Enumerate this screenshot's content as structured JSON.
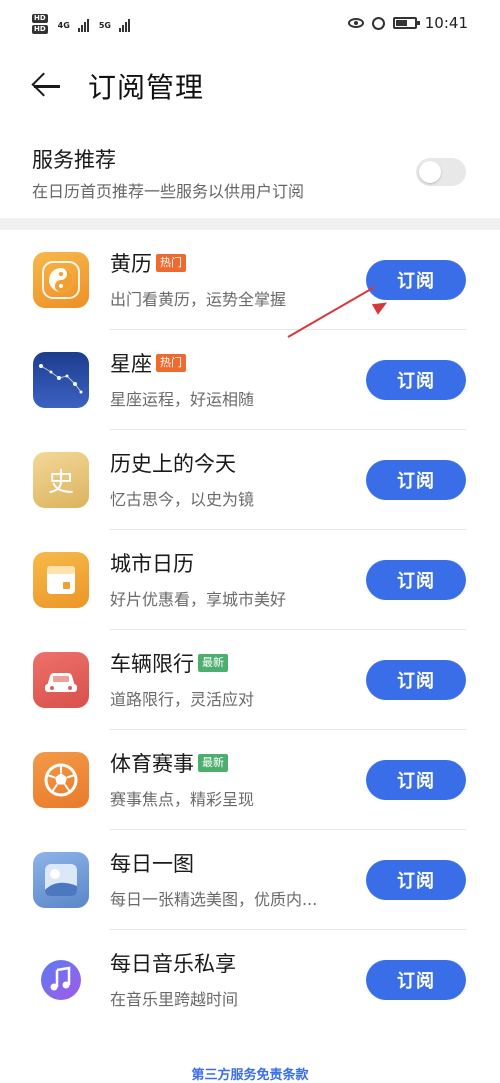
{
  "status_bar": {
    "sim1": "HD",
    "sim2": "HD",
    "net1": "4G",
    "net2": "5G",
    "time": "10:41"
  },
  "header": {
    "title": "订阅管理"
  },
  "recommend": {
    "title": "服务推荐",
    "description": "在日历首页推荐一些服务以供用户订阅",
    "enabled": false
  },
  "services": [
    {
      "name": "黄历",
      "badge": "热门",
      "badge_type": "hot",
      "description": "出门看黄历，运势全掌握",
      "button": "订阅",
      "icon": "yin-yang-icon",
      "color": "#f3a23a"
    },
    {
      "name": "星座",
      "badge": "热门",
      "badge_type": "hot",
      "description": "星座运程，好运相随",
      "button": "订阅",
      "icon": "constellation-icon",
      "color": "#2d4ea8"
    },
    {
      "name": "历史上的今天",
      "badge": "",
      "badge_type": "",
      "description": "忆古思今，以史为镜",
      "button": "订阅",
      "icon": "history-icon",
      "color": "#e8c677",
      "glyph": "史"
    },
    {
      "name": "城市日历",
      "badge": "",
      "badge_type": "",
      "description": "好片优惠看，享城市美好",
      "button": "订阅",
      "icon": "calendar-icon",
      "color": "#f1a93a"
    },
    {
      "name": "车辆限行",
      "badge": "最新",
      "badge_type": "new",
      "description": "道路限行，灵活应对",
      "button": "订阅",
      "icon": "car-icon",
      "color": "#e0605a"
    },
    {
      "name": "体育赛事",
      "badge": "最新",
      "badge_type": "new",
      "description": "赛事焦点，精彩呈现",
      "button": "订阅",
      "icon": "soccer-ball-icon",
      "color": "#ee8a3a"
    },
    {
      "name": "每日一图",
      "badge": "",
      "badge_type": "",
      "description": "每日一张精选美图，优质内...",
      "button": "订阅",
      "icon": "photo-icon",
      "color": "#6f9ad6"
    },
    {
      "name": "每日音乐私享",
      "badge": "",
      "badge_type": "",
      "description": "在音乐里跨越时间",
      "button": "订阅",
      "icon": "music-note-icon",
      "color": "#ffffff"
    }
  ],
  "footer": {
    "link": "第三方服务免责条款"
  },
  "colors": {
    "accent": "#3a6ee8",
    "hot_badge": "#ee6a2f",
    "new_badge": "#4caf70",
    "annotation_arrow": "#d9383b"
  }
}
